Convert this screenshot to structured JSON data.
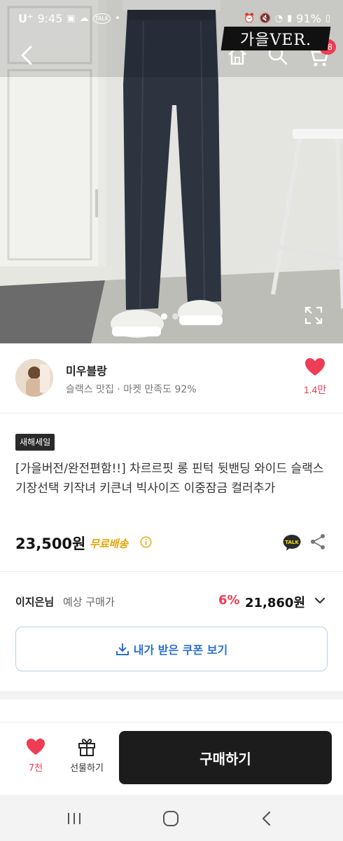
{
  "status_bar": {
    "carrier": "U⁺",
    "time": "9:45",
    "battery": "91%"
  },
  "header": {
    "brand_stamp": "가을VER.",
    "cart_count": "68"
  },
  "gallery": {
    "current_index": 1,
    "total": 2
  },
  "seller": {
    "name": "미우블랑",
    "subtitle": "슬랙스 맛집 · 마켓 만족도 92%",
    "like_count": "1.4만"
  },
  "product": {
    "badge": "새해세일",
    "title": "[가을버전/완전편함!!] 차르르핏 롱 핀턱 뒷밴딩 와이드 슬랙스 기장선택 키작녀 키큰녀 빅사이즈 이중잠금 컬러추가",
    "price": "23,500원",
    "shipping": "무료배송"
  },
  "member_price": {
    "name": "이지은님",
    "label": "예상 구매가",
    "discount": "6%",
    "price": "21,860원"
  },
  "coupon": {
    "label": "내가 받은 쿠폰 보기"
  },
  "bottom_bar": {
    "wish_count": "7천",
    "gift_label": "선물하기",
    "buy_label": "구매하기"
  },
  "colors": {
    "accent_pink": "#ee3d54",
    "coupon_blue": "#2c6fd1",
    "shipping_yellow": "#e7a400",
    "buy_button": "#1c1c1c"
  }
}
